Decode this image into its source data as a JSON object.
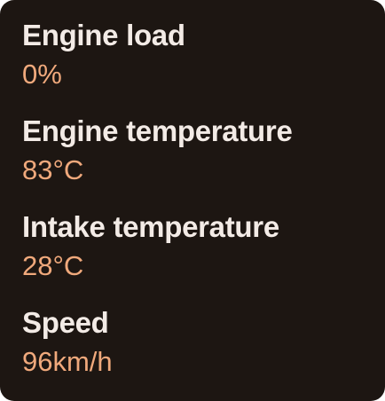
{
  "metrics": [
    {
      "label": "Engine load",
      "value": "0%"
    },
    {
      "label": "Engine temperature",
      "value": "83°C"
    },
    {
      "label": "Intake temperature",
      "value": "28°C"
    },
    {
      "label": "Speed",
      "value": "96km/h"
    }
  ],
  "colors": {
    "background": "#1d1612",
    "label": "#f3ebe6",
    "value": "#f0a97c"
  }
}
